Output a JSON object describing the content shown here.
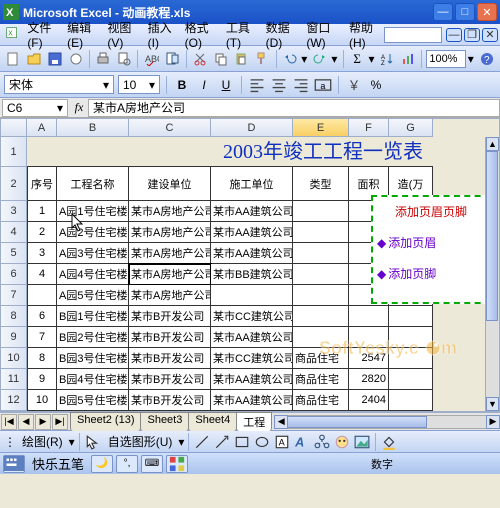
{
  "window": {
    "title": "Microsoft Excel - 动画教程.xls"
  },
  "menu": {
    "items": [
      "文件(F)",
      "编辑(E)",
      "视图(V)",
      "插入(I)",
      "格式(O)",
      "工具(T)",
      "数据(D)",
      "窗口(W)",
      "帮助(H)"
    ],
    "askbox": ""
  },
  "toolbar": {
    "zoom": "100%"
  },
  "format": {
    "font": "宋体",
    "size": "10"
  },
  "formula": {
    "namebox": "C6",
    "fx": "fx",
    "value": "某市A房地产公司"
  },
  "columns": [
    "",
    "A",
    "B",
    "C",
    "D",
    "E",
    "F",
    "G"
  ],
  "sheet_title": "2003年竣工工程一览表",
  "headers": [
    "序号",
    "工程名称",
    "建设单位",
    "施工单位",
    "类型",
    "面积",
    "造(万"
  ],
  "rows": [
    {
      "n": "1",
      "name": "A园1号住宅楼",
      "dev": "某市A房地产公司",
      "con": "某市AA建筑公司",
      "type": "",
      "area": "",
      "cost": ""
    },
    {
      "n": "2",
      "name": "A园2号住宅楼",
      "dev": "某市A房地产公司",
      "con": "某市AA建筑公司",
      "type": "",
      "area": "",
      "cost": ""
    },
    {
      "n": "3",
      "name": "A园3号住宅楼",
      "dev": "某市A房地产公司",
      "con": "某市AA建筑公司",
      "type": "",
      "area": "",
      "cost": ""
    },
    {
      "n": "4",
      "name": "A园4号住宅楼",
      "dev": "某市A房地产公司",
      "con": "某市BB建筑公司",
      "type": "",
      "area": "",
      "cost": ""
    },
    {
      "n": "",
      "name": "A园5号住宅楼",
      "dev": "某市A房地产公司",
      "con": "",
      "type": "",
      "area": "",
      "cost": ""
    },
    {
      "n": "6",
      "name": "B园1号住宅楼",
      "dev": "某市B开发公司",
      "con": "某市CC建筑公司",
      "type": "",
      "area": "",
      "cost": ""
    },
    {
      "n": "7",
      "name": "B园2号住宅楼",
      "dev": "某市B开发公司",
      "con": "某市AA建筑公司",
      "type": "",
      "area": "",
      "cost": ""
    },
    {
      "n": "8",
      "name": "B园3号住宅楼",
      "dev": "某市B开发公司",
      "con": "某市CC建筑公司",
      "type": "商品住宅",
      "area": "2547",
      "cost": ""
    },
    {
      "n": "9",
      "name": "B园4号住宅楼",
      "dev": "某市B开发公司",
      "con": "某市AA建筑公司",
      "type": "商品住宅",
      "area": "2820",
      "cost": ""
    },
    {
      "n": "10",
      "name": "B园5号住宅楼",
      "dev": "某市B开发公司",
      "con": "某市AA建筑公司",
      "type": "商品住宅",
      "area": "2404",
      "cost": ""
    }
  ],
  "popup": {
    "title": "添加页眉页脚",
    "items": [
      "添加页眉",
      "添加页脚"
    ]
  },
  "watermark": {
    "text1": "SoftYesky",
    "text2": ".c",
    "text3": "m"
  },
  "tabs": {
    "nav": [
      "|◀",
      "◀",
      "▶",
      "▶|"
    ],
    "items": [
      "Sheet2 (13)",
      "Sheet3",
      "Sheet4",
      "工程"
    ],
    "active": 3
  },
  "drawbar": {
    "draw": "绘图(R)",
    "autoshapes": "自选图形(U)"
  },
  "ime": {
    "name": "快乐五笔"
  },
  "status": {
    "mode": "数字"
  }
}
